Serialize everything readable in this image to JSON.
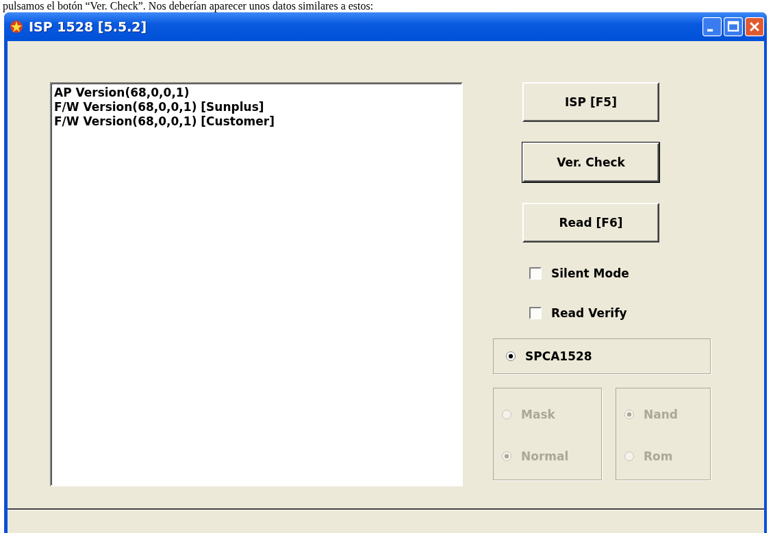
{
  "caption": "pulsamos el botón “Ver. Check”. Nos deberían aparecer unos datos similares a estos:",
  "window": {
    "title": "ISP 1528 [5.5.2]"
  },
  "output_lines": [
    "AP Version(68,0,0,1)",
    "F/W Version(68,0,0,1) [Sunplus]",
    "F/W Version(68,0,0,1) [Customer]"
  ],
  "buttons": [
    {
      "label": "ISP [F5]",
      "default": false
    },
    {
      "label": "Ver. Check",
      "default": true
    },
    {
      "label": "Read [F6]",
      "default": false
    }
  ],
  "checkboxes": [
    {
      "label": "Silent Mode",
      "checked": false
    },
    {
      "label": "Read Verify",
      "checked": false
    }
  ],
  "chip_group": [
    {
      "label": "SPCA1528",
      "selected": true,
      "disabled": false
    }
  ],
  "mode_group": [
    {
      "label": "Mask",
      "selected": false,
      "disabled": true
    },
    {
      "label": "Normal",
      "selected": true,
      "disabled": true
    }
  ],
  "memory_group": [
    {
      "label": "Nand",
      "selected": true,
      "disabled": true
    },
    {
      "label": "Rom",
      "selected": false,
      "disabled": true
    }
  ]
}
